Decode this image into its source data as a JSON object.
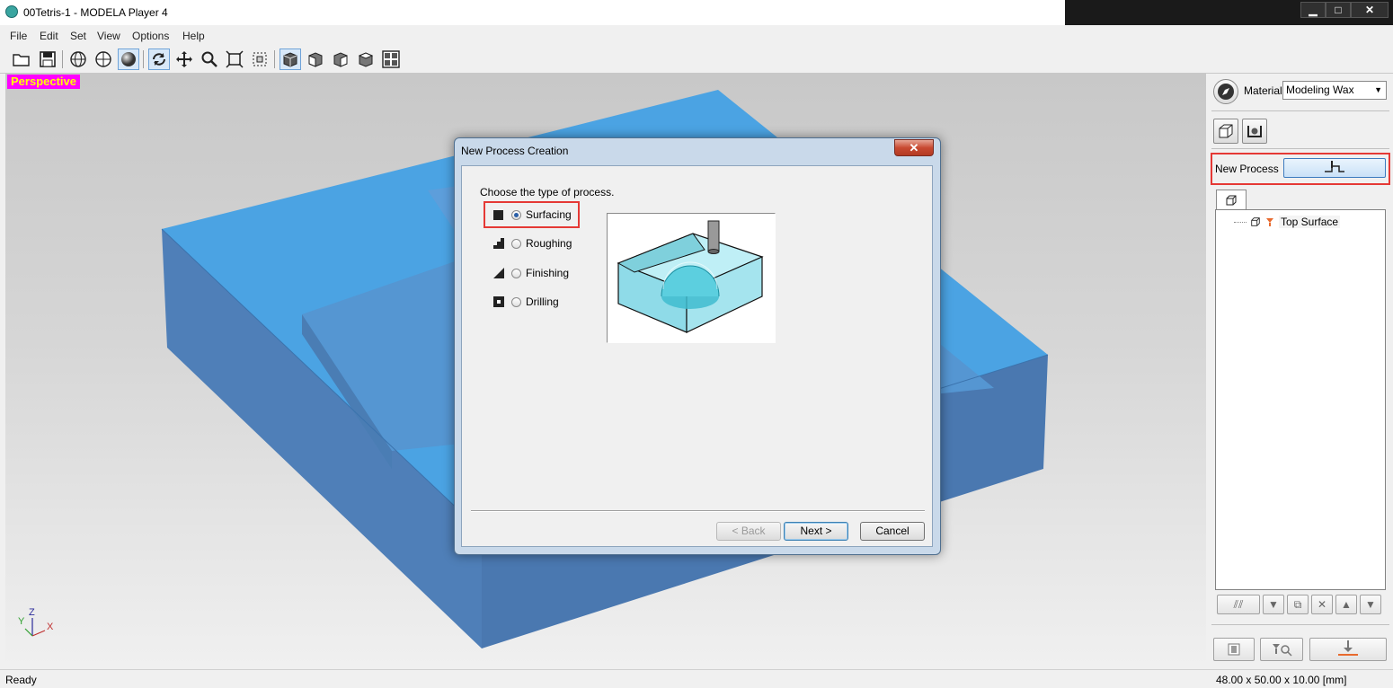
{
  "window": {
    "title": "00Tetris-1 - MODELA Player 4",
    "controls": {
      "minimize": "▁",
      "maximize": "□",
      "close": "✕"
    }
  },
  "menu": [
    "File",
    "Edit",
    "Set",
    "View",
    "Options",
    "Help"
  ],
  "toolbar": {
    "icons": [
      "open-icon",
      "save-icon",
      "wireframe-icon",
      "hidden-line-icon",
      "shaded-icon",
      "rotate-icon",
      "pan-icon",
      "zoom-icon",
      "fit-icon",
      "zoom-box-icon",
      "view-iso-icon",
      "view-front-icon",
      "view-side-icon",
      "view-top-icon",
      "multi-view-icon"
    ]
  },
  "viewport": {
    "view_label": "Perspective",
    "model_color": "#4ba3e3",
    "axes": {
      "x": "X",
      "y": "Y",
      "z": "Z"
    }
  },
  "right_panel": {
    "material_label": "Material",
    "material_value": "Modeling Wax",
    "new_process_label": "New Process",
    "tree": [
      {
        "label": "Top Surface"
      }
    ]
  },
  "dialog": {
    "title": "New Process Creation",
    "prompt": "Choose the type of process.",
    "options": [
      {
        "label": "Surfacing",
        "selected": true
      },
      {
        "label": "Roughing",
        "selected": false
      },
      {
        "label": "Finishing",
        "selected": false
      },
      {
        "label": "Drilling",
        "selected": false
      }
    ],
    "buttons": {
      "back": "< Back",
      "next": "Next >",
      "cancel": "Cancel"
    },
    "close": "✕"
  },
  "status": {
    "text": "Ready",
    "dimensions": "48.00 x 50.00 x 10.00 [mm]"
  },
  "colors": {
    "highlight": "#e53935",
    "perspective_bg": "#ff00ff",
    "perspective_fg": "#ffff00"
  }
}
